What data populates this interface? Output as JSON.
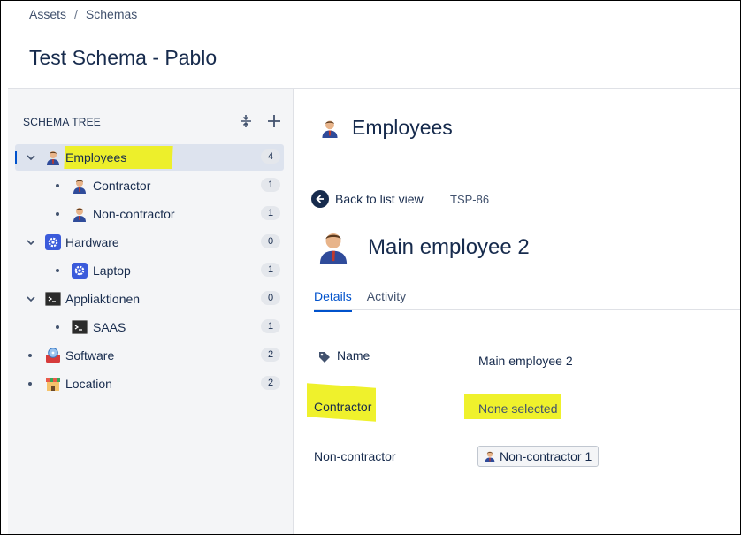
{
  "breadcrumb": [
    "Assets",
    "Schemas"
  ],
  "page_title": "Test Schema - Pablo",
  "sidebar": {
    "heading": "SCHEMA TREE",
    "items": [
      {
        "label": "Employees",
        "count": "4",
        "icon": "employee-icon"
      },
      {
        "label": "Contractor",
        "count": "1",
        "icon": "employee-icon"
      },
      {
        "label": "Non-contractor",
        "count": "1",
        "icon": "employee-icon"
      },
      {
        "label": "Hardware",
        "count": "0",
        "icon": "gear-icon"
      },
      {
        "label": "Laptop",
        "count": "1",
        "icon": "gear-icon"
      },
      {
        "label": "Appliaktionen",
        "count": "0",
        "icon": "terminal-icon"
      },
      {
        "label": "SAAS",
        "count": "1",
        "icon": "terminal-icon"
      },
      {
        "label": "Software",
        "count": "2",
        "icon": "software-disc-icon"
      },
      {
        "label": "Location",
        "count": "2",
        "icon": "storefront-icon"
      }
    ]
  },
  "main": {
    "object_type": "Employees",
    "back_label": "Back to list view",
    "object_key": "TSP-86",
    "entry_title": "Main employee 2",
    "tabs": [
      "Details",
      "Activity"
    ],
    "attributes": [
      {
        "label": "Name",
        "value": "Main employee 2"
      },
      {
        "label": "Contractor",
        "value": "None selected"
      },
      {
        "label": "Non-contractor",
        "value": "Non-contractor 1"
      }
    ]
  },
  "colors": {
    "highlight": "#eef01a",
    "accent": "#0052cc",
    "selected_row": "#dde3ee"
  }
}
